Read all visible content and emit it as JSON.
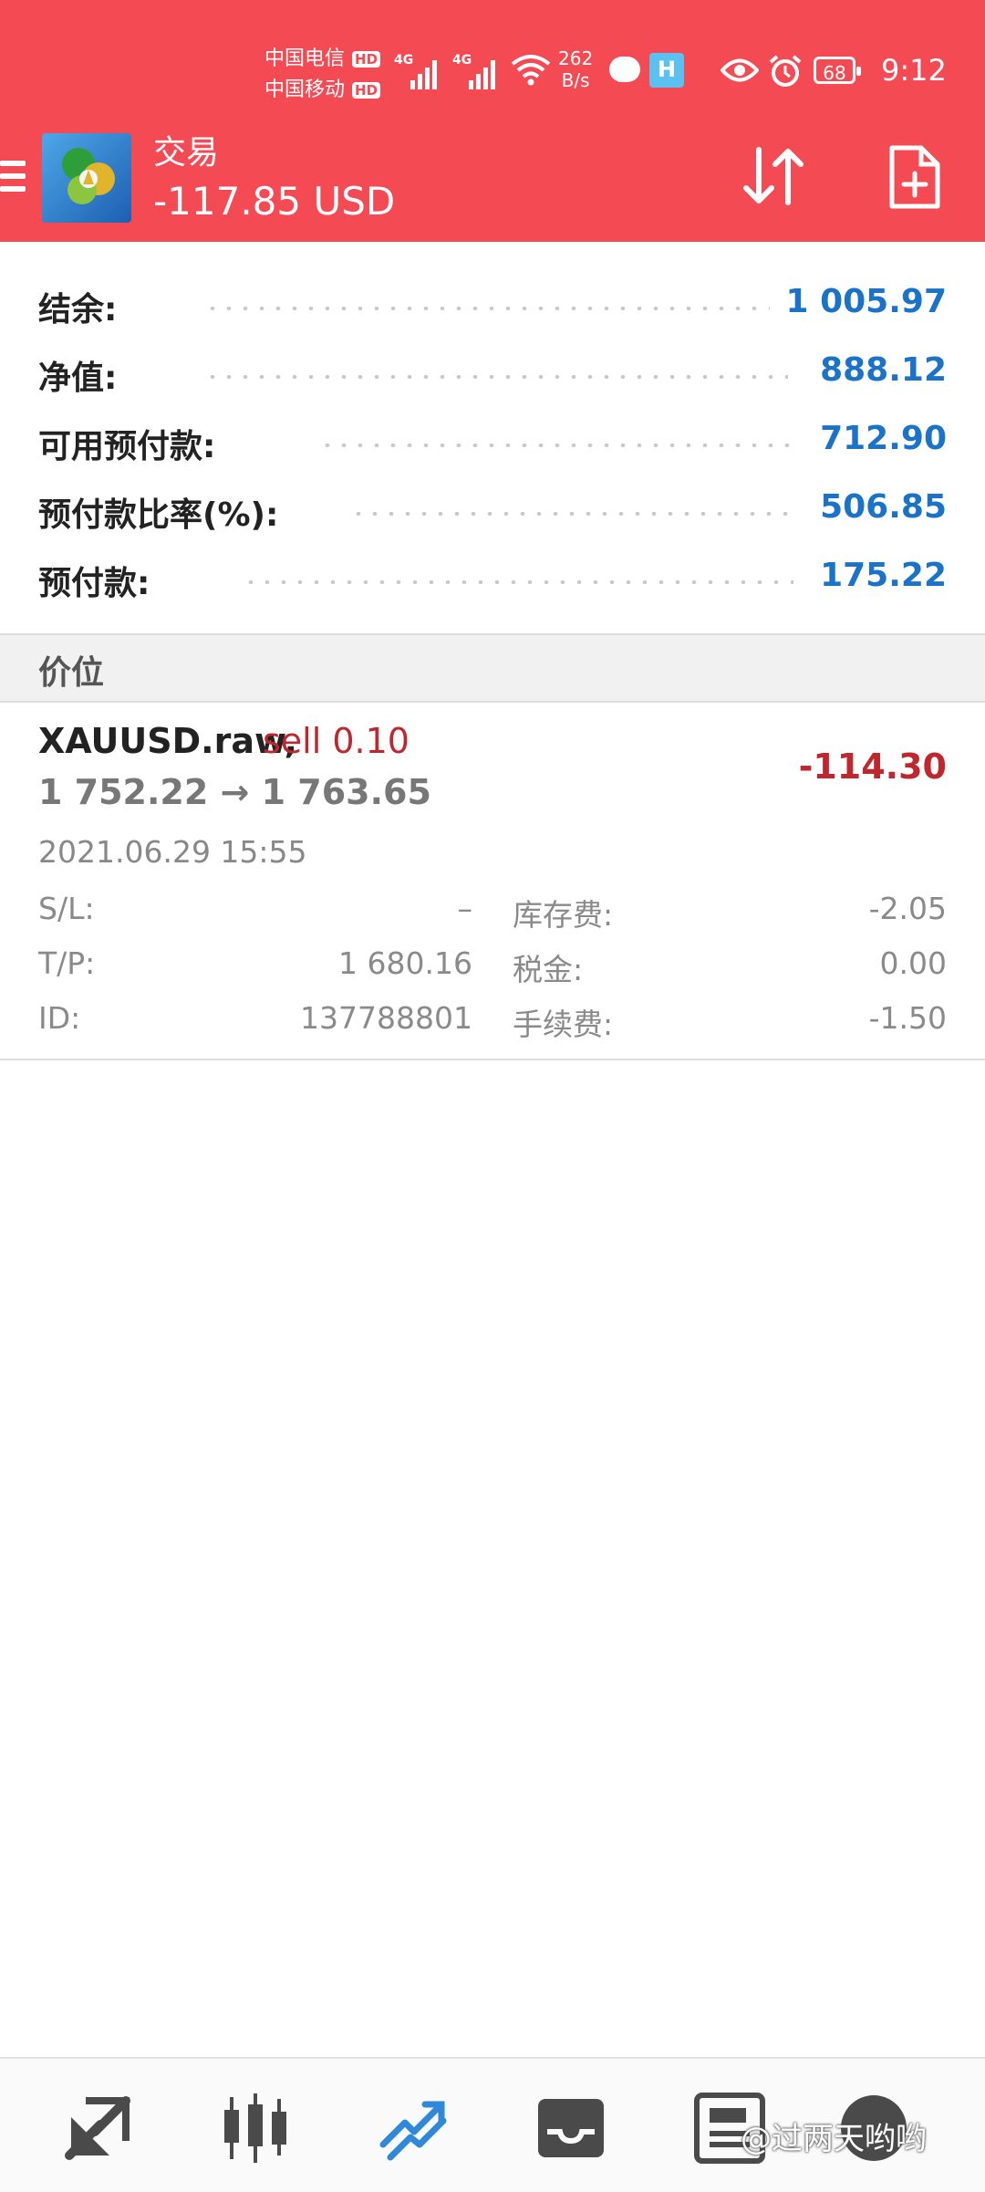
{
  "status_bar": {
    "carrier1": "中国电信",
    "carrier2": "中国移动",
    "hd_label": "HD",
    "network_type": "4G",
    "net_speed_value": "262",
    "net_speed_unit": "B/s",
    "battery": "68",
    "time": "9:12"
  },
  "header": {
    "title": "交易",
    "balance": "-117.85 USD",
    "background_color": "#f34a53"
  },
  "account": {
    "rows": [
      {
        "label": "结余:",
        "value": "1 005.97"
      },
      {
        "label": "净值:",
        "value": "888.12"
      },
      {
        "label": "可用预付款:",
        "value": "712.90"
      },
      {
        "label": "预付款比率(%):",
        "value": "506.85"
      },
      {
        "label": "预付款:",
        "value": "175.22"
      }
    ],
    "value_color": "#1a73c8"
  },
  "section": {
    "label": "价位"
  },
  "position": {
    "symbol": "XAUUSD.raw,",
    "side": "sell 0.10",
    "prices": "1 752.22 → 1 763.65",
    "profit": "-114.30",
    "time": "2021.06.29 15:55",
    "details": {
      "sl_label": "S/L:",
      "sl_value": "–",
      "tp_label": "T/P:",
      "tp_value": "1 680.16",
      "id_label": "ID:",
      "id_value": "137788801",
      "swap_label": "库存费:",
      "swap_value": "-2.05",
      "tax_label": "税金:",
      "tax_value": "0.00",
      "commission_label": "手续费:",
      "commission_value": "-1.50"
    },
    "loss_color": "#c0262d"
  },
  "bottom_nav": {
    "items": [
      "quotes-icon",
      "chart-icon",
      "trade-icon",
      "history-icon",
      "news-icon",
      "messages-icon"
    ],
    "active": "trade-icon"
  },
  "watermark": "@过两天哟哟"
}
